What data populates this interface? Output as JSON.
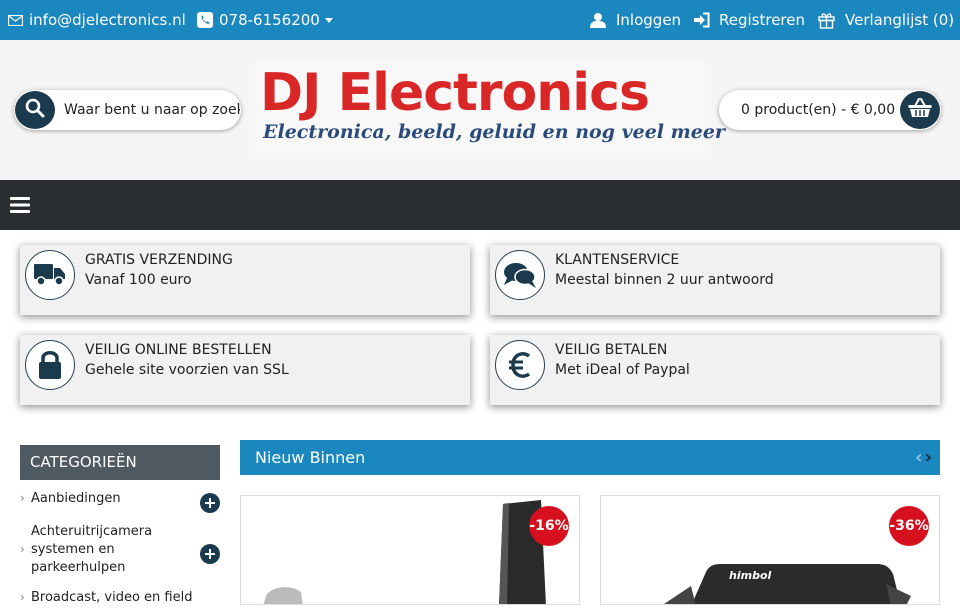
{
  "topbar": {
    "email": "info@djelectronics.nl",
    "phone": "078-6156200",
    "login": "Inloggen",
    "register": "Registreren",
    "wishlist": "Verlanglijst (0)"
  },
  "header": {
    "search_placeholder": "Waar bent u naar op zoek?",
    "logo_title": "DJ Electronics",
    "logo_tagline": "Electronica, beeld, geluid en nog veel meer",
    "cart_summary": "0 product(en) - € 0,00"
  },
  "features": [
    {
      "title": "GRATIS VERZENDING",
      "subtitle": "Vanaf 100 euro",
      "icon": "truck-icon"
    },
    {
      "title": "KLANTENSERVICE",
      "subtitle": "Meestal binnen 2 uur antwoord",
      "icon": "chat-icon"
    },
    {
      "title": "VEILIG ONLINE BESTELLEN",
      "subtitle": "Gehele site voorzien van SSL",
      "icon": "lock-icon"
    },
    {
      "title": "VEILIG BETALEN",
      "subtitle": "Met iDeal of Paypal",
      "icon": "euro-icon"
    }
  ],
  "sidebar": {
    "heading": "CATEGORIEËN",
    "items": [
      {
        "label": "Aanbiedingen"
      },
      {
        "label": "Achteruitrijcamera systemen en parkeerhulpen"
      },
      {
        "label": "Broadcast, video en field"
      }
    ]
  },
  "new_in": {
    "heading": "Nieuw Binnen",
    "products": [
      {
        "discount": "-16%"
      },
      {
        "discount": "-36%",
        "brand": "himbol"
      }
    ]
  },
  "colors": {
    "topbar": "#1a87bf",
    "nav": "#2b2e30",
    "dark_button": "#1b3a4e",
    "badge": "#d6101e",
    "logo_red": "#d92626"
  }
}
